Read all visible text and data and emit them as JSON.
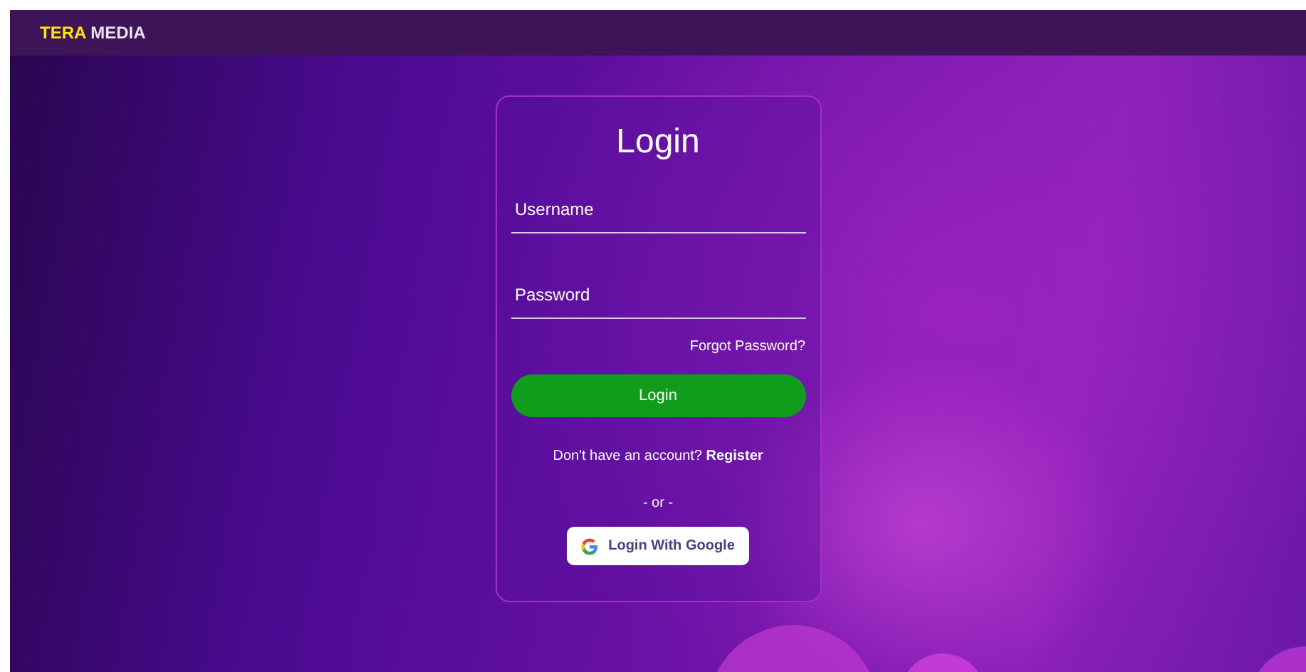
{
  "navbar": {
    "brand": [
      {
        "text": "TERA",
        "kind": "accent"
      },
      {
        "text": "MEDIA",
        "kind": "plain"
      }
    ]
  },
  "login_card": {
    "title": "Login",
    "fields": [
      {
        "placeholder": "Username"
      },
      {
        "placeholder": "Password"
      }
    ],
    "forgot_link": "Forgot Password?",
    "login_button": "Login",
    "register_prompt": {
      "text": "Don't have an account?",
      "link": "Register"
    },
    "separator": "- or -",
    "google_button": "Login With Google"
  }
}
